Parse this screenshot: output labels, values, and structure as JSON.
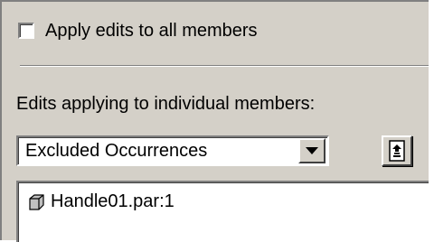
{
  "apply_all": {
    "label": "Apply edits to all members",
    "checked": false
  },
  "individual": {
    "label": "Edits applying to individual members:"
  },
  "edit_type": {
    "selected": "Excluded Occurrences"
  },
  "members": [
    {
      "name": "Handle01.par:1",
      "icon": "part-icon"
    }
  ]
}
